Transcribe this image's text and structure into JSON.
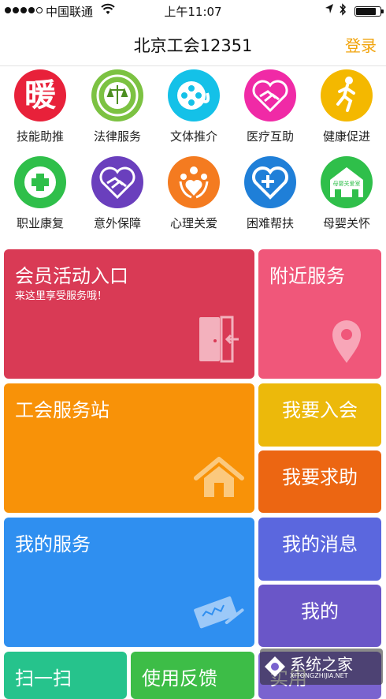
{
  "status_bar": {
    "carrier": "中国联通",
    "time": "上午11:07"
  },
  "nav": {
    "title": "北京工会12351",
    "login": "登录"
  },
  "icons": [
    {
      "label": "技能助推",
      "icon": "warmth-character-icon",
      "color": "#e8213a"
    },
    {
      "label": "法律服务",
      "icon": "legal-emblem-icon",
      "color": "#7cc242"
    },
    {
      "label": "文体推介",
      "icon": "film-reel-icon",
      "color": "#14c1e8"
    },
    {
      "label": "医疗互助",
      "icon": "handshake-heart-icon",
      "color": "#f02aa6"
    },
    {
      "label": "健康促进",
      "icon": "runner-icon",
      "color": "#f4b800"
    },
    {
      "label": "职业康复",
      "icon": "medical-cross-icon",
      "color": "#2fbf4a"
    },
    {
      "label": "意外保障",
      "icon": "handshake-heart-icon",
      "color": "#6a3fbd"
    },
    {
      "label": "心理关爱",
      "icon": "caring-people-icon",
      "color": "#f47b20"
    },
    {
      "label": "困难帮扶",
      "icon": "heart-cross-icon",
      "color": "#1f7fd8"
    },
    {
      "label": "母婴关怀",
      "icon": "maternity-house-icon",
      "color": "#2fbf4a",
      "sign": "母婴关爱室"
    }
  ],
  "tiles": {
    "member_activity": {
      "title": "会员活动入口",
      "subtitle": "来这里享受服务哦！",
      "color": "#d93a55"
    },
    "nearby": {
      "title": "附近服务",
      "color": "#f0577a"
    },
    "station": {
      "title": "工会服务站",
      "color": "#f89208"
    },
    "join": {
      "title": "我要入会",
      "color": "#ecb90b"
    },
    "help": {
      "title": "我要求助",
      "color": "#ec6612"
    },
    "my_service": {
      "title": "我的服务",
      "color": "#2f8ff0"
    },
    "my_messages": {
      "title": "我的消息",
      "color": "#5b67de"
    },
    "me": {
      "title": "我的",
      "color": "#6a56c8"
    },
    "scan": {
      "title": "扫一扫",
      "color": "#26c38c"
    },
    "feedback": {
      "title": "使用反馈",
      "color": "#3dbd47"
    },
    "practical": {
      "title": "实用",
      "color": "#7a63cf"
    }
  },
  "watermark": {
    "text": "系统之家",
    "url": "XITONGZHIJIA.NET"
  }
}
